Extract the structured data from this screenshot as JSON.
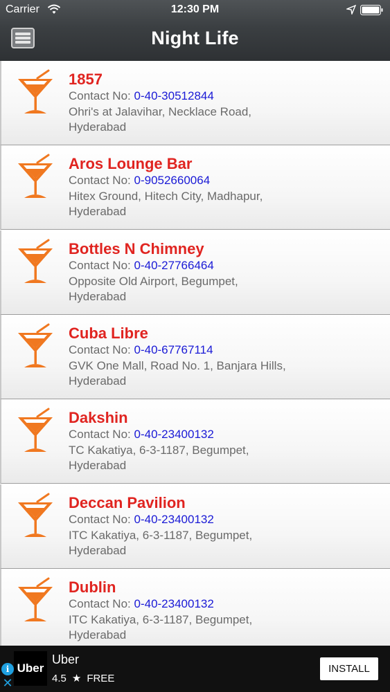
{
  "status_bar": {
    "carrier": "Carrier",
    "time": "12:30 PM",
    "wifi_icon": "wifi-icon",
    "location_icon": "location-arrow-icon",
    "battery_icon": "battery-icon"
  },
  "nav": {
    "title": "Night Life",
    "menu_icon": "menu-icon"
  },
  "colors": {
    "name": "#e02420",
    "phone": "#1a1ad6",
    "icon": "#f07820"
  },
  "list": {
    "contact_label": "Contact No: ",
    "icon": "cocktail-glass-icon",
    "items": [
      {
        "name": "1857",
        "phone": "0-40-30512844",
        "address": "Ohri's at Jalavihar, Necklace Road, Hyderabad"
      },
      {
        "name": "Aros Lounge Bar",
        "phone": "0-9052660064",
        "address": "Hitex Ground, Hitech City, Madhapur, Hyderabad"
      },
      {
        "name": "Bottles N Chimney",
        "phone": "0-40-27766464",
        "address": "Opposite Old Airport, Begumpet, Hyderabad"
      },
      {
        "name": "Cuba Libre",
        "phone": "0-40-67767114",
        "address": "GVK One Mall, Road No. 1, Banjara Hills, Hyderabad"
      },
      {
        "name": "Dakshin",
        "phone": "0-40-23400132",
        "address": "TC Kakatiya, 6-3-1187, Begumpet, Hyderabad"
      },
      {
        "name": "Deccan Pavilion",
        "phone": "0-40-23400132",
        "address": "ITC Kakatiya, 6-3-1187, Begumpet, Hyderabad"
      },
      {
        "name": "Dublin",
        "phone": "0-40-23400132",
        "address": "ITC Kakatiya, 6-3-1187, Begumpet, Hyderabad"
      }
    ]
  },
  "ad": {
    "info_icon": "info-icon",
    "close_icon": "close-icon",
    "logo_text": "Uber",
    "title": "Uber",
    "rating": "4.5",
    "star_icon": "star-icon",
    "price": "FREE",
    "install_label": "INSTALL"
  }
}
